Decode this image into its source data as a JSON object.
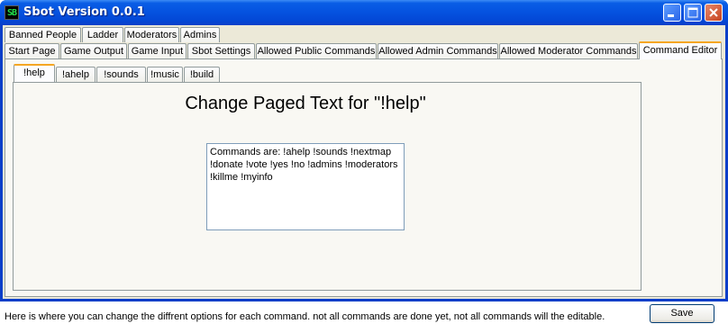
{
  "window": {
    "title": "Sbot Version 0.0.1",
    "icon_text": "SB",
    "accent_color": "#0553e0"
  },
  "tabs_row1": [
    "Banned People",
    "Ladder",
    "Moderators",
    "Admins"
  ],
  "tabs_row2": [
    "Start Page",
    "Game Output",
    "Game Input",
    "Sbot Settings",
    "Allowed Public Commands",
    "Allowed Admin Commands",
    "Allowed Moderator Commands",
    "Command Editor"
  ],
  "active_tab": "Command Editor",
  "command_tabs": [
    "!help",
    "!ahelp",
    "!sounds",
    "!music",
    "!build"
  ],
  "active_command_tab": "!help",
  "editor": {
    "heading": "Change Paged Text for \"!help\"",
    "text": "Commands are: !ahelp !sounds !nextmap\n!donate !vote !yes !no !admins !moderators\n!killme !myinfo"
  },
  "save_label": "Save",
  "caption": "Here is where you can change the diffrent options for each command. not all commands are done yet, not all commands will the editable."
}
